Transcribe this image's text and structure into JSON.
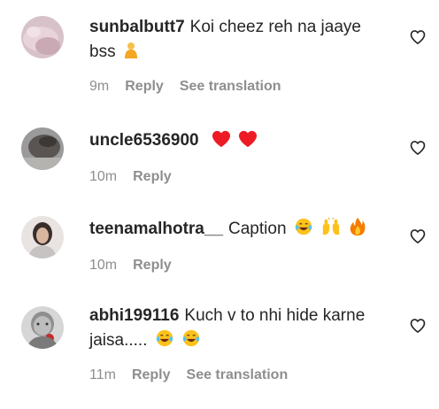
{
  "comments": [
    {
      "username": "sunbalbutt7",
      "text": "Koi cheez reh na jaaye bss",
      "emojis": [
        "person-emoji"
      ],
      "time": "9m",
      "reply_label": "Reply",
      "translation_label": "See translation"
    },
    {
      "username": "uncle6536900",
      "text": "",
      "emojis": [
        "red-heart-emoji",
        "red-heart-emoji"
      ],
      "time": "10m",
      "reply_label": "Reply"
    },
    {
      "username": "teenamalhotra__",
      "text": "Caption",
      "emojis": [
        "laughing-tears-emoji",
        "raised-hands-emoji",
        "fire-emoji"
      ],
      "time": "10m",
      "reply_label": "Reply"
    },
    {
      "username": "abhi199116",
      "text": "Kuch v to nhi hide karne jaisa.....",
      "emojis": [
        "laughing-tears-emoji",
        "laughing-tears-emoji"
      ],
      "time": "11m",
      "reply_label": "Reply",
      "translation_label": "See translation"
    }
  ],
  "colors": {
    "text": "#262626",
    "meta": "#8e8e8e",
    "heart_emoji": "#ed1c24",
    "background": "#ffffff"
  },
  "icons": {
    "like": "heart-outline-icon"
  }
}
